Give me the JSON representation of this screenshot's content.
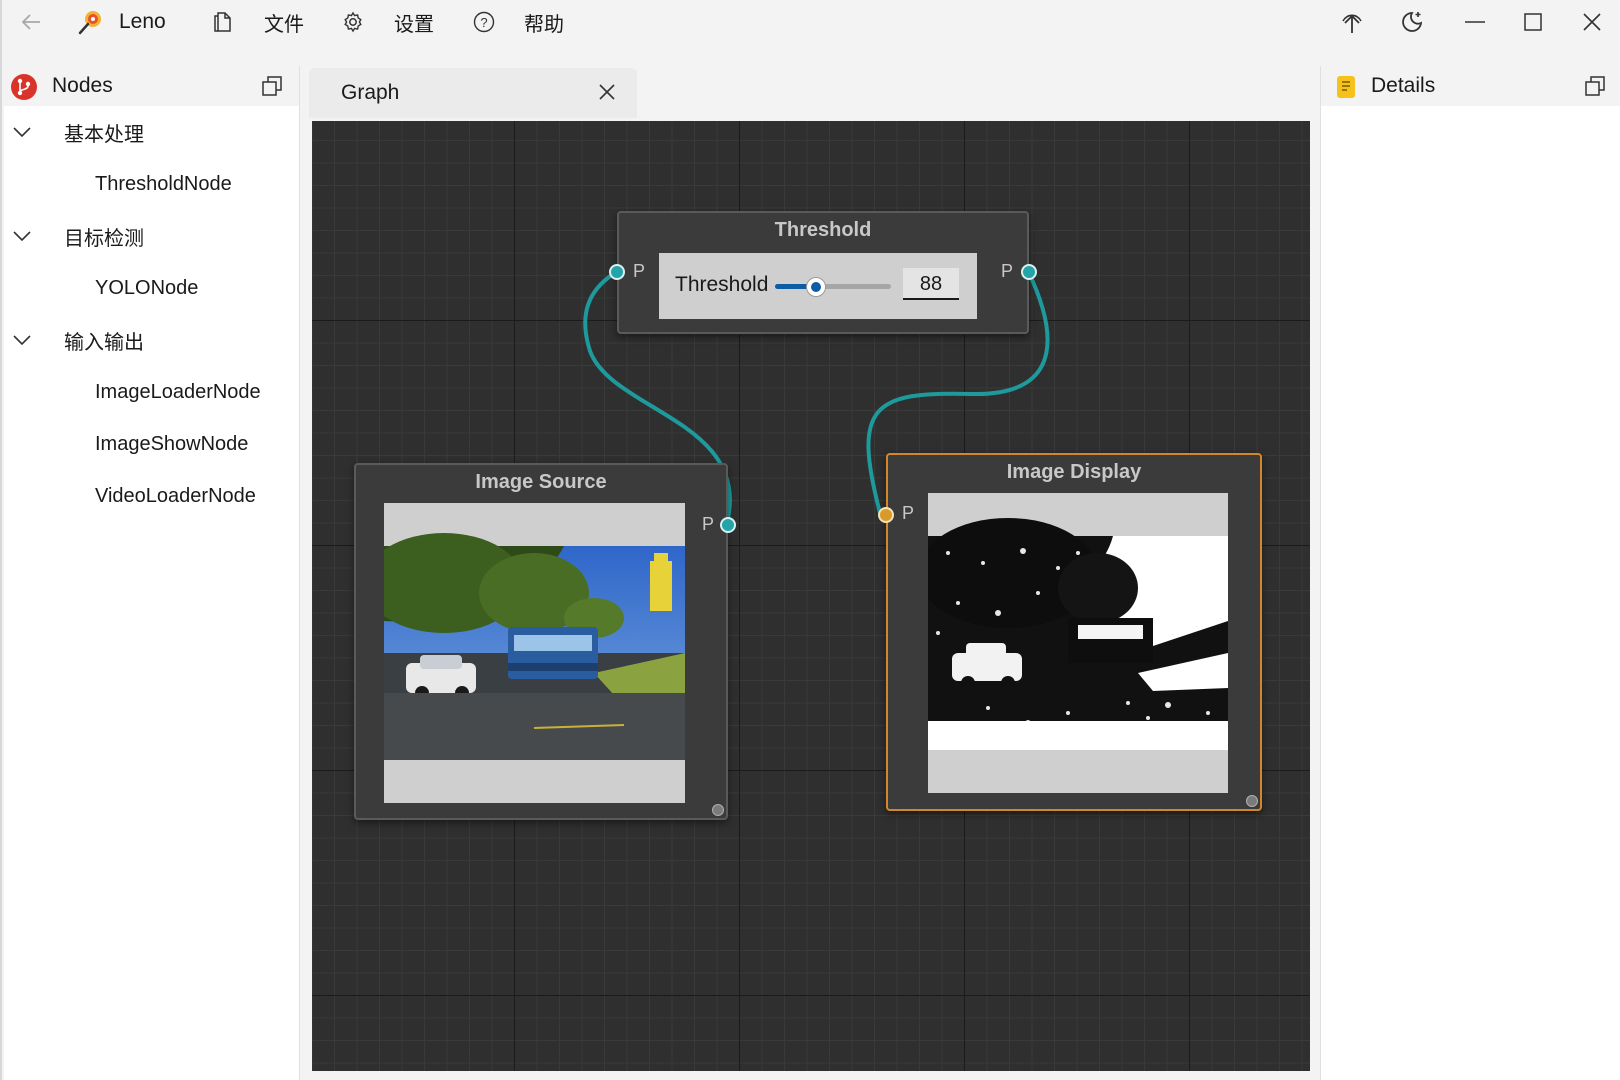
{
  "titlebar": {
    "app_name": "Leno",
    "menu_file": "文件",
    "menu_settings": "设置",
    "menu_help": "帮助"
  },
  "nodes_panel": {
    "title": "Nodes",
    "groups": [
      {
        "label": "基本处理",
        "items": [
          "ThresholdNode"
        ]
      },
      {
        "label": "目标检测",
        "items": [
          "YOLONode"
        ]
      },
      {
        "label": "输入输出",
        "items": [
          "ImageLoaderNode",
          "ImageShowNode",
          "VideoLoaderNode"
        ]
      }
    ]
  },
  "graph_tab": {
    "label": "Graph"
  },
  "graph": {
    "threshold_node": {
      "title": "Threshold",
      "in_port": "P",
      "out_port": "P",
      "param_label": "Threshold",
      "value": "88",
      "slider_fraction": 0.35
    },
    "image_source_node": {
      "title": "Image Source",
      "out_port": "P"
    },
    "image_display_node": {
      "title": "Image Display",
      "in_port": "P"
    }
  },
  "details_panel": {
    "title": "Details"
  },
  "colors": {
    "wire": "#1f9a9c",
    "port": "#24a4a9",
    "selected_border": "#d2882a",
    "canvas": "#2f2f2f",
    "accent": "#0d5ca6"
  }
}
